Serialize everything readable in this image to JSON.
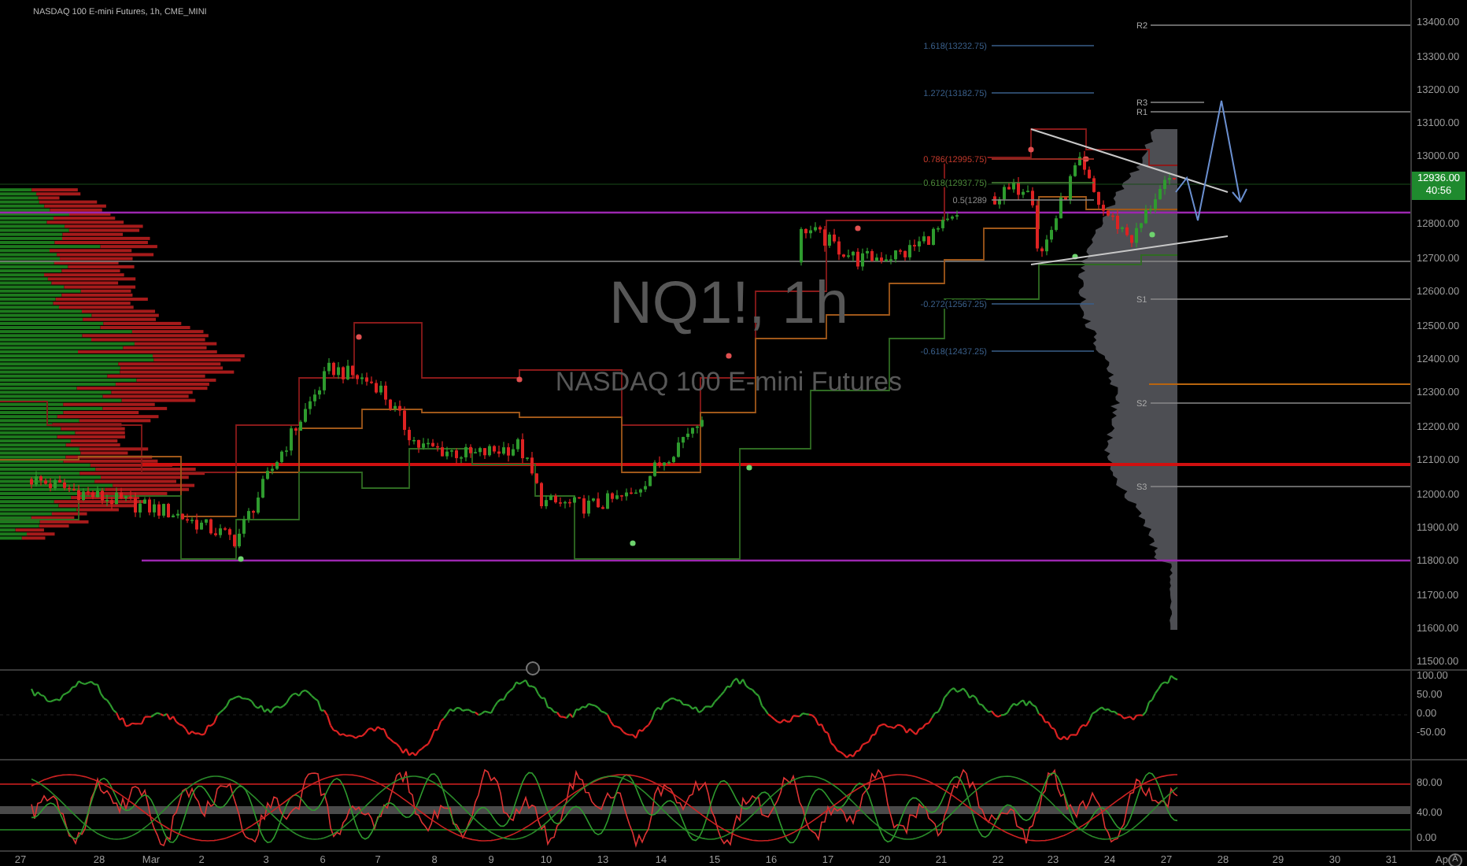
{
  "chart": {
    "title": "NASDAQ 100 E-mini Futures, 1h, CME_MINI",
    "watermark_symbol": "NQ1!, 1h",
    "watermark_name": "NASDAQ 100 E-mini Futures",
    "fib_levels": [
      {
        "label": "1.618(13232.75)"
      },
      {
        "label": "1.272(13182.75)"
      },
      {
        "label": "0.786(12995.75)"
      },
      {
        "label": "0.618(12937.75)"
      },
      {
        "label": "0.5(1289"
      },
      {
        "label": "-0.272(12567.25)"
      },
      {
        "label": "-0.618(12437.25)"
      }
    ],
    "pivots": [
      {
        "label": "R2"
      },
      {
        "label": "R3"
      },
      {
        "label": "R1"
      },
      {
        "label": "S1"
      },
      {
        "label": "S2"
      },
      {
        "label": "S3"
      }
    ],
    "price_axis": [
      "13400.00",
      "13300.00",
      "13200.00",
      "13100.00",
      "13000.00",
      "12800.00",
      "12700.00",
      "12600.00",
      "12500.00",
      "12400.00",
      "12300.00",
      "12200.00",
      "12100.00",
      "12000.00",
      "11900.00",
      "11800.00",
      "11700.00",
      "11600.00",
      "11500.00"
    ],
    "last_price": {
      "value": "12936.00",
      "countdown": "40:56"
    }
  },
  "rsi_panel": {
    "axis": [
      "100.00",
      "50.00",
      "0.00",
      "-50.00"
    ]
  },
  "stoch_panel": {
    "axis": [
      "80.00",
      "40.00",
      "0.00"
    ]
  },
  "time_axis": [
    "27",
    "28",
    "Mar",
    "2",
    "3",
    "6",
    "7",
    "8",
    "9",
    "10",
    "13",
    "14",
    "15",
    "16",
    "17",
    "20",
    "21",
    "22",
    "23",
    "24",
    "27",
    "28",
    "29",
    "30",
    "31",
    "Ap"
  ],
  "auto_button": "A"
}
